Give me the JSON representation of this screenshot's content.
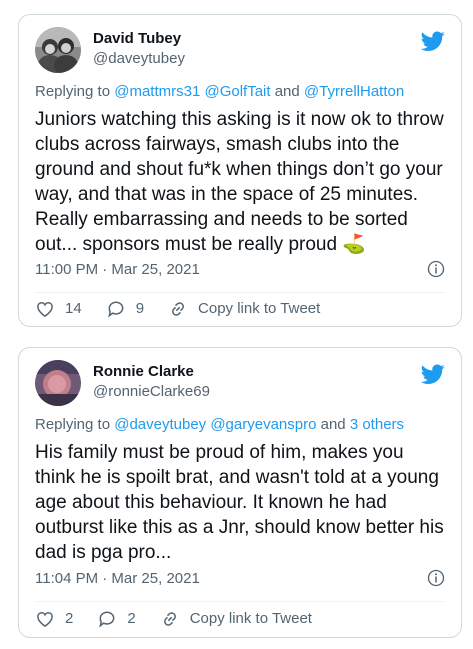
{
  "tweets": [
    {
      "name": "David Tubey",
      "handle": "@daveytubey",
      "replying_prefix": "Replying to ",
      "replying_links": "@mattmrs31 @GolfTait",
      "replying_and": " and ",
      "replying_rest": "@TyrrellHatton",
      "text": "Juniors watching this asking is it now ok to throw clubs across fairways, smash clubs into the ground and shout fu*k when things don’t go your way, and that was in the space of 25 minutes. Really embarrassing and needs to be sorted out... sponsors must be really proud ⛳",
      "timestamp": "11:00 PM · Mar 25, 2021",
      "likes": "14",
      "replies": "9",
      "copy_link_label": "Copy link to Tweet"
    },
    {
      "name": "Ronnie Clarke",
      "handle": "@ronnieClarke69",
      "replying_prefix": "Replying to ",
      "replying_links": "@daveytubey @garyevanspro",
      "replying_and": " and ",
      "replying_rest": "3 others",
      "text": "His family must be proud of him, makes you think he is spoilt brat, and wasn't told at a young age about this behaviour. It known he had outburst like this as a Jnr, should know better his dad is pga pro...",
      "timestamp": "11:04 PM · Mar 25, 2021",
      "likes": "2",
      "replies": "2",
      "copy_link_label": "Copy link to Tweet"
    }
  ],
  "colors": {
    "twitter_blue": "#1d9bf0",
    "secondary_text": "#536471",
    "border": "#cfd9de"
  },
  "icons": [
    "twitter-bird-icon",
    "info-icon",
    "heart-icon",
    "reply-icon",
    "link-icon"
  ]
}
